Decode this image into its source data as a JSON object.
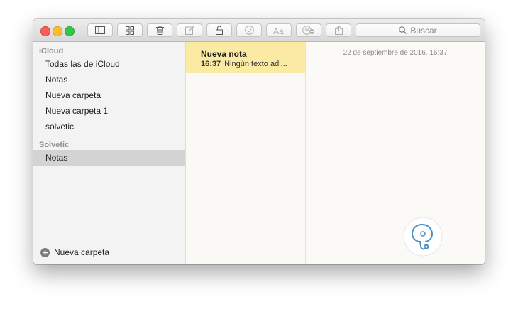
{
  "toolbar": {
    "search_label": "Buscar",
    "buttons": [
      {
        "icon": "sidebar-toggle-icon"
      },
      {
        "icon": "attachments-grid-icon"
      },
      {
        "icon": "trash-icon"
      },
      {
        "icon": "compose-icon"
      },
      {
        "icon": "lock-icon"
      },
      {
        "icon": "checklist-icon"
      },
      {
        "icon": "font-style-icon"
      },
      {
        "icon": "add-people-icon"
      },
      {
        "icon": "share-icon"
      }
    ]
  },
  "sidebar": {
    "icloud_header": "iCloud",
    "icloud_items": [
      {
        "label": "Todas las de iCloud"
      },
      {
        "label": "Notas"
      },
      {
        "label": "Nueva carpeta"
      },
      {
        "label": "Nueva carpeta 1"
      },
      {
        "label": "solvetic"
      }
    ],
    "solvetic_header": "Solvetic",
    "solvetic_items": [
      {
        "label": "Notas",
        "selected": true
      }
    ],
    "new_folder_label": "Nueva carpeta"
  },
  "notes": [
    {
      "title": "Nueva nota",
      "time": "16:37",
      "preview": "Ningún texto adi..."
    }
  ],
  "editor": {
    "date": "22 de septiembre de 2016, 16:37"
  },
  "colors": {
    "selected_note_bg": "#fbeaa4",
    "selected_folder_bg": "#d3d3d3",
    "logo_blue": "#4a8fc7"
  }
}
